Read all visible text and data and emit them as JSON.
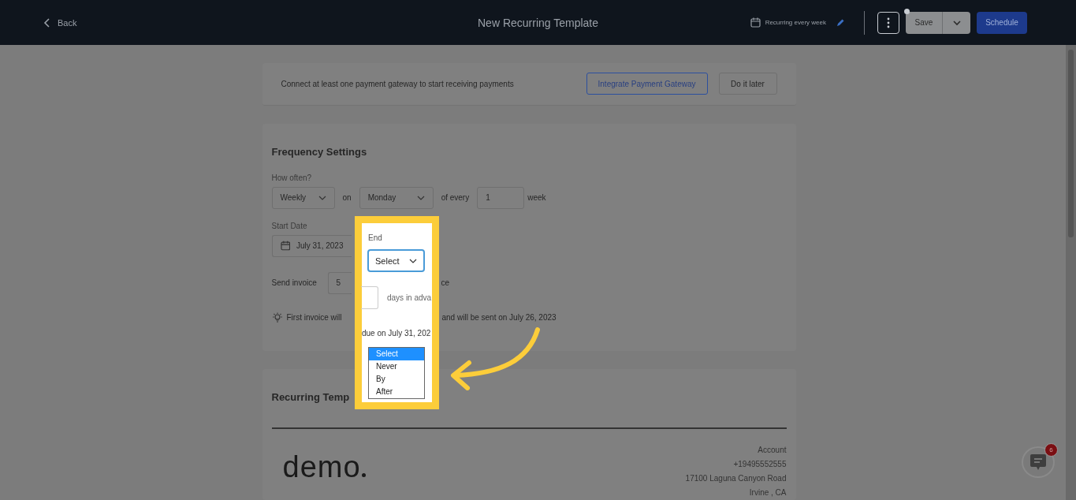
{
  "header": {
    "back": "Back",
    "title": "New Recurring Template",
    "recurrence": "Recurring every week",
    "save": "Save",
    "schedule": "Schedule"
  },
  "gateway_banner": {
    "message": "Connect at least one payment gateway to start receiving payments",
    "integrate": "Integrate Payment Gateway",
    "later": "Do it later"
  },
  "frequency": {
    "title": "Frequency Settings",
    "how_often_label": "How often?",
    "period": "Weekly",
    "on_label": "on",
    "day": "Monday",
    "of_every_label": "of every",
    "interval": "1",
    "unit": "week",
    "start_label": "Start Date",
    "start_date": "July 31, 2023",
    "send_label": "Send invoice",
    "days": "5",
    "advance_visible": "days in adva",
    "advance_tail": "ce",
    "note_start": "First invoice will",
    "note_end": "and will be sent on July 26, 2023"
  },
  "spotlight": {
    "end_label": "End",
    "end_value": "Select",
    "note_middle": "due on July 31, 202",
    "options": [
      {
        "label": "Select",
        "selected": true
      },
      {
        "label": "Never",
        "selected": false
      },
      {
        "label": "By",
        "selected": false
      },
      {
        "label": "After",
        "selected": false
      }
    ]
  },
  "template": {
    "title": "Recurring Temp",
    "logo": "demo",
    "address": [
      "Account",
      "+19495552555",
      "17100 Laguna Canyon Road",
      "Irvine , CA"
    ]
  },
  "chat": {
    "badge": "6"
  }
}
